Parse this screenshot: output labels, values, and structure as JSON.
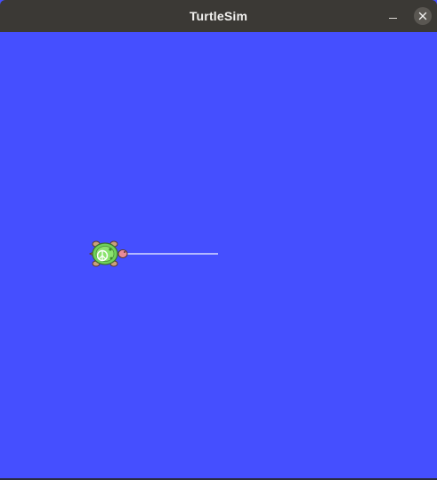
{
  "window": {
    "title": "TurtleSim"
  },
  "titlebar_icons": {
    "minimize": "minimize-icon",
    "close": "close-icon"
  },
  "canvas": {
    "background_color": "#454FFF",
    "trail_color": "#B3B8FF"
  },
  "turtle": {
    "icon": "turtle-icon",
    "shell_color": "#6FD25A",
    "body_color": "#C9A07E"
  }
}
